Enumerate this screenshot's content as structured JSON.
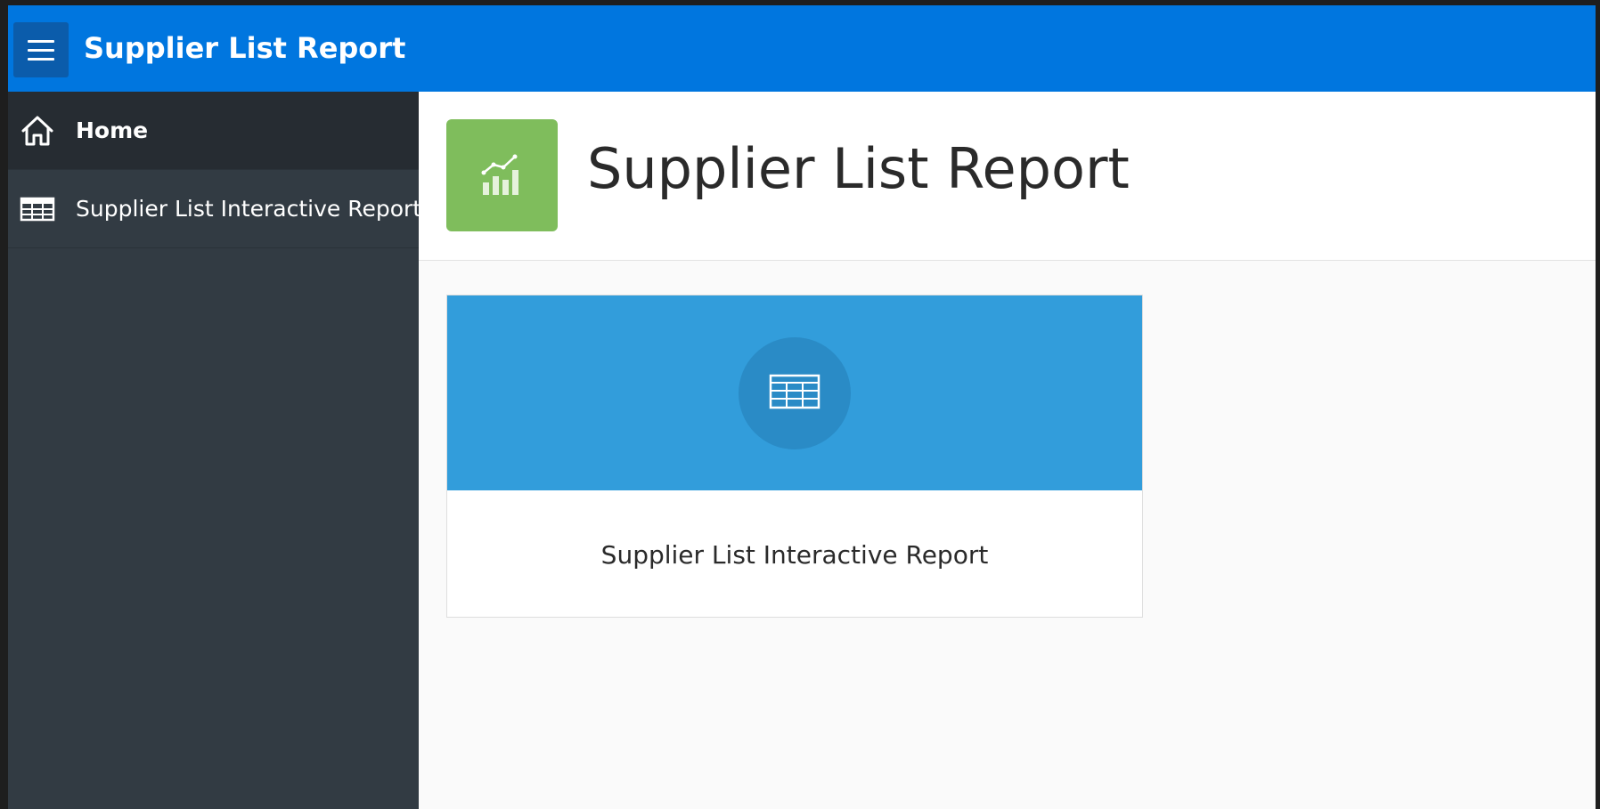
{
  "header": {
    "menu_icon": "hamburger-icon",
    "app_title": "Supplier List Report"
  },
  "sidebar": {
    "items": [
      {
        "label": "Home",
        "icon": "home-icon",
        "active": true
      },
      {
        "label": "Supplier List Interactive Report",
        "icon": "table-icon",
        "active": false
      }
    ]
  },
  "hero": {
    "icon": "chart-icon",
    "title": "Supplier List Report"
  },
  "cards": [
    {
      "label": "Supplier List Interactive Report",
      "icon": "table-icon"
    }
  ],
  "colors": {
    "header_bg": "#0076df",
    "sidebar_bg": "#323b43",
    "sidebar_active_bg": "#262c32",
    "hero_icon_bg": "#7fbd5c",
    "card_top_bg": "#329ddb"
  }
}
